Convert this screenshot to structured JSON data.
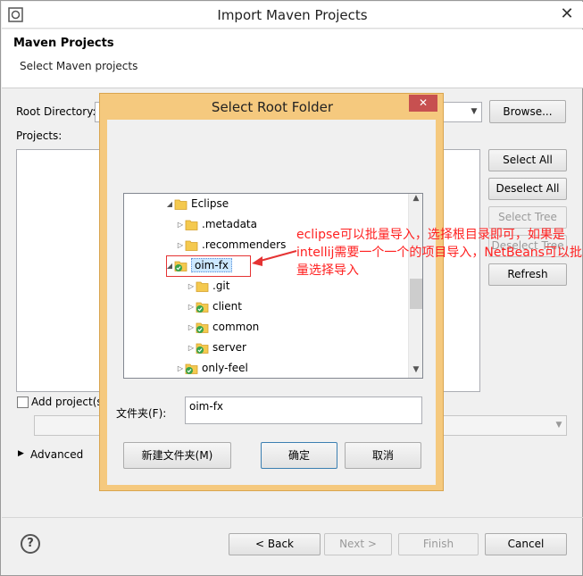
{
  "window": {
    "title": "Import Maven Projects",
    "close_glyph": "✕"
  },
  "header": {
    "title": "Maven Projects",
    "subtitle": "Select Maven projects"
  },
  "form": {
    "root_directory_label": "Root Directory:",
    "browse_label": "Browse...",
    "projects_label": "Projects:",
    "add_project_label": "Add project(s",
    "advanced_label": "Advanced"
  },
  "side_buttons": {
    "select_all": "Select All",
    "deselect_all": "Deselect All",
    "select_tree": "Select Tree",
    "deselect_tree": "Deselect Tree",
    "refresh": "Refresh"
  },
  "footer": {
    "help_glyph": "?",
    "back": "< Back",
    "next": "Next >",
    "finish": "Finish",
    "cancel": "Cancel"
  },
  "dialog": {
    "title": "Select Root Folder",
    "close_glyph": "✕",
    "folder_label": "文件夹(F):",
    "folder_value": "oim-fx",
    "new_folder": "新建文件夹(M)",
    "ok": "确定",
    "cancel": "取消",
    "tree": [
      {
        "label": "Eclipse",
        "expanded": true,
        "icon": "folder-icon"
      },
      {
        "label": ".metadata",
        "expanded": false,
        "icon": "folder-icon"
      },
      {
        "label": ".recommenders",
        "expanded": false,
        "icon": "folder-icon"
      },
      {
        "label": "oim-fx",
        "expanded": true,
        "icon": "git-folder-icon",
        "selected": true
      },
      {
        "label": ".git",
        "expanded": false,
        "icon": "folder-icon"
      },
      {
        "label": "client",
        "expanded": false,
        "icon": "git-folder-icon"
      },
      {
        "label": "common",
        "expanded": false,
        "icon": "git-folder-icon"
      },
      {
        "label": "server",
        "expanded": false,
        "icon": "git-folder-icon"
      },
      {
        "label": "only-feel",
        "expanded": false,
        "icon": "git-folder-icon"
      }
    ]
  },
  "annotation": {
    "text": "eclipse可以批量导入，选择根目录即可，如果是intellij需要一个一个的项目导入，NetBeans可以批量选择导入",
    "color": "#ff2020"
  }
}
